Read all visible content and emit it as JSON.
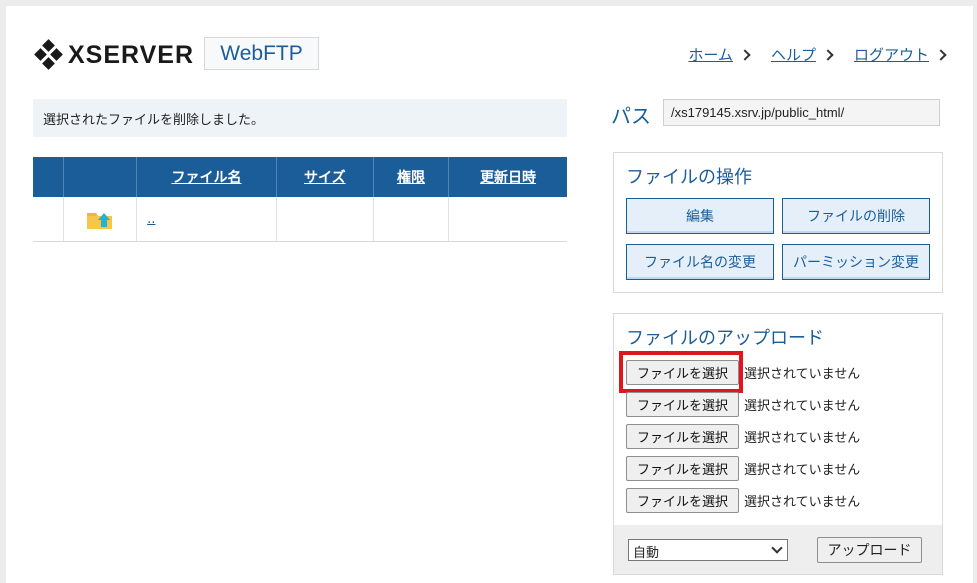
{
  "header": {
    "logo_text": "XSERVER",
    "app_name": "WebFTP",
    "nav": [
      {
        "label": "ホーム"
      },
      {
        "label": "ヘルプ"
      },
      {
        "label": "ログアウト"
      }
    ]
  },
  "message": "選択されたファイルを削除しました。",
  "table": {
    "columns": [
      "",
      "",
      "ファイル名",
      "サイズ",
      "権限",
      "更新日時"
    ],
    "rows": [
      {
        "icon": "folder-up-icon",
        "name": "..",
        "size": "",
        "perm": "",
        "date": ""
      }
    ]
  },
  "path": {
    "label": "パス",
    "value": "/xs179145.xsrv.jp/public_html/"
  },
  "operations": {
    "title": "ファイルの操作",
    "buttons": [
      "編集",
      "ファイルの削除",
      "ファイル名の変更",
      "パーミッション変更"
    ]
  },
  "upload": {
    "title": "ファイルのアップロード",
    "choose_label": "ファイルを選択",
    "no_file_text": "選択されていません",
    "slots": 5,
    "mode_value": "自動",
    "upload_label": "アップロード"
  },
  "colors": {
    "brand_blue": "#1b5d98",
    "highlight_red": "#e0161e"
  }
}
